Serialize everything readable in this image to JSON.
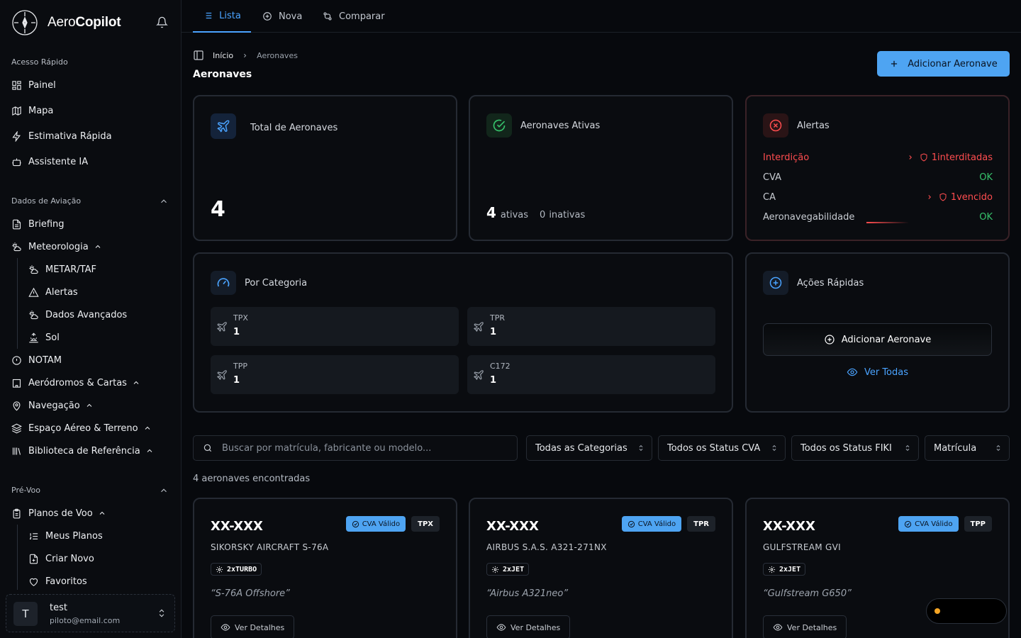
{
  "brand": {
    "name_light": "Aero",
    "name_bold": "Copilot"
  },
  "sidebar": {
    "quick_access": {
      "title": "Acesso Rápido",
      "items": [
        {
          "label": "Painel"
        },
        {
          "label": "Mapa"
        },
        {
          "label": "Estimativa Rápida"
        },
        {
          "label": "Assistente IA"
        }
      ]
    },
    "aviation_data": {
      "title": "Dados de Aviação",
      "briefing": "Briefing",
      "meteorologia": "Meteorologia",
      "met_sub": [
        "METAR/TAF",
        "Alertas",
        "Dados Avançados",
        "Sol"
      ],
      "notam": "NOTAM",
      "aerodromos": "Aeródromos & Cartas",
      "navegacao": "Navegação",
      "espaco": "Espaço Aéreo & Terreno",
      "biblioteca": "Biblioteca de Referência"
    },
    "preflight": {
      "title": "Pré-Voo",
      "planos": "Planos de Voo",
      "plan_sub": [
        "Meus Planos",
        "Criar Novo",
        "Favoritos"
      ]
    },
    "user": {
      "initial": "T",
      "name": "test",
      "email": "piloto@email.com"
    }
  },
  "tabs": [
    "Lista",
    "Nova",
    "Comparar"
  ],
  "breadcrumb": {
    "home": "Início",
    "current": "Aeronaves"
  },
  "page_title": "Aeronaves",
  "add_button": "Adicionar Aeronave",
  "stats": {
    "total": {
      "title": "Total de Aeronaves",
      "value": "4"
    },
    "active": {
      "title": "Aeronaves Ativas",
      "active_count": "4",
      "active_label": "ativas",
      "inactive_count": "0",
      "inactive_label": "inativas"
    },
    "alerts": {
      "title": "Alertas",
      "rows": [
        {
          "label": "Interdição",
          "value": "1interditadas",
          "status": "bad"
        },
        {
          "label": "CVA",
          "value": "OK",
          "status": "ok"
        },
        {
          "label": "CA",
          "value": "1vencido",
          "status": "bad"
        },
        {
          "label": "Aeronavegabilidade",
          "value": "OK",
          "status": "ok"
        }
      ]
    }
  },
  "categories": {
    "title": "Por Categoria",
    "items": [
      {
        "label": "TPX",
        "value": "1"
      },
      {
        "label": "TPR",
        "value": "1"
      },
      {
        "label": "TPP",
        "value": "1"
      },
      {
        "label": "C172",
        "value": "1"
      }
    ]
  },
  "quick_actions": {
    "title": "Ações Rápidas",
    "add": "Adicionar Aeronave",
    "view_all": "Ver Todas"
  },
  "filters": {
    "search_placeholder": "Buscar por matrícula, fabricante ou modelo...",
    "category": "Todas as Categorias",
    "cva_status": "Todos os Status CVA",
    "fiki_status": "Todos os Status FIKI",
    "sort": "Matrícula"
  },
  "results_count": "4 aeronaves encontradas",
  "aircraft": [
    {
      "registration": "XX-XXX",
      "cva": "CVA Válido",
      "category": "TPX",
      "manufacturer": "SIKORSKY AIRCRAFT S-76A",
      "engine": "2xTURBO",
      "model": "“S-76A Offshore”",
      "details": "Ver Detalhes"
    },
    {
      "registration": "XX-XXX",
      "cva": "CVA Válido",
      "category": "TPR",
      "manufacturer": "AIRBUS S.A.S. A321-271NX",
      "engine": "2xJET",
      "model": "“Airbus A321neo”",
      "details": "Ver Detalhes"
    },
    {
      "registration": "XX-XXX",
      "cva": "CVA Válido",
      "category": "TPP",
      "manufacturer": "GULFSTREAM GVI",
      "engine": "2xJET",
      "model": "“Gulfstream G650”",
      "details": "Ver Detalhes"
    }
  ],
  "colors": {
    "accent": "#4ea4f2",
    "danger": "#ff4d4f",
    "ok": "#36c26b",
    "warning_dot": "#f5a524"
  }
}
